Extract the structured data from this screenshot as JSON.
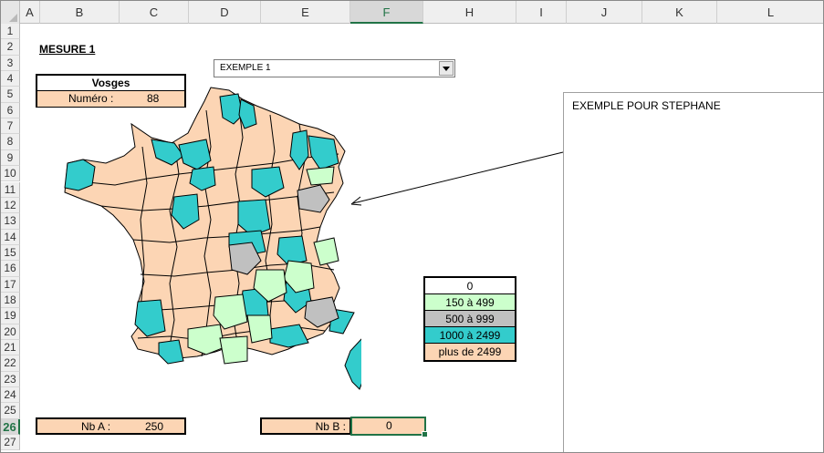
{
  "columns": [
    "A",
    "B",
    "C",
    "D",
    "E",
    "F",
    "H",
    "I",
    "J",
    "K",
    "L"
  ],
  "selected_column": "F",
  "rows": [
    "1",
    "2",
    "3",
    "4",
    "5",
    "6",
    "7",
    "8",
    "9",
    "10",
    "11",
    "12",
    "13",
    "14",
    "15",
    "16",
    "17",
    "18",
    "19",
    "20",
    "21",
    "22",
    "23",
    "24",
    "25",
    "26",
    "27"
  ],
  "selected_row": "26",
  "sheet": {
    "title": "MESURE    1",
    "dropdown_value": "EXEMPLE 1",
    "region_name": "Vosges",
    "number_label": "Numéro :",
    "number_value": "88",
    "comment_text": "EXEMPLE POUR STEPHANE",
    "nb_a_label": "Nb A :",
    "nb_a_value": "250",
    "nb_b_label": "Nb B :",
    "nb_b_value": "0"
  },
  "legend": [
    {
      "label": "0",
      "color": "#ffffff"
    },
    {
      "label": "150 à 499",
      "color": "#ccffcc"
    },
    {
      "label": "500 à 999",
      "color": "#c0c0c0"
    },
    {
      "label": "1000 à 2499",
      "color": "#33cccc"
    },
    {
      "label": "plus de 2499",
      "color": "#fcd5b4"
    }
  ],
  "colors": {
    "peach": "#fcd5b4",
    "teal": "#33cccc",
    "green": "#ccffcc",
    "gray": "#c0c0c0",
    "accent": "#217346"
  }
}
